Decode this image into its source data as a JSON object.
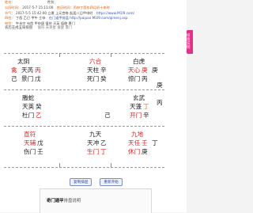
{
  "header": {
    "lines": [
      {
        "label": "姓名：",
        "value": "",
        "extra": "性别："
      },
      {
        "label": "公历时间：",
        "value": "2017-5-7 15:11:00",
        "extra": "农历时间：丙申丁酉年四月初十申时"
      },
      {
        "label": "节气：",
        "value": "2017-5-5 15:42:00 立夏 上元宫卷 起居八日甲申时",
        "extra": "https://www.M1I9.com/"
      },
      {
        "label": "四柱：",
        "value": "丁酉 乙巳 甲午 壬申",
        "extra": "在门道甲排盘 http://paipan.M1I9.com/qimenj.asp"
      },
      {
        "label": "旬空：",
        "value": "午未空 旬首 甲申庚 值符 天英 值使 景门",
        "extra": ""
      }
    ],
    "subline": "农历壬戌五局排盘",
    "subline_gray": "值符 天英星  值使 景门"
  },
  "cells": [
    {
      "god": "太阴",
      "rows": [
        [
          "禽",
          "天芮",
          "丙"
        ],
        [
          "己",
          "景门",
          "戊"
        ]
      ]
    },
    {
      "god": "六合",
      "rows": [
        [
          "",
          "天柱",
          "辛"
        ],
        [
          "",
          "死门",
          "癸"
        ]
      ]
    },
    {
      "god": "白虎",
      "rows": [
        [
          "",
          "天心",
          "庚"
        ],
        [
          "",
          "惊门",
          "丙"
        ]
      ]
    },
    {
      "god": "螣蛇",
      "rows": [
        [
          "",
          "天英",
          "癸"
        ],
        [
          "",
          "杜门",
          "乙"
        ]
      ]
    },
    {
      "god": "",
      "rows": [
        [
          "",
          "",
          ""
        ],
        [
          "",
          "",
          "己"
        ]
      ]
    },
    {
      "god": "玄武",
      "rows": [
        [
          "",
          "天蓬",
          "丁"
        ],
        [
          "",
          "开门",
          "辛"
        ]
      ]
    },
    {
      "god": "直符",
      "rows": [
        [
          "",
          "天辅",
          "戊"
        ],
        [
          "",
          "伤门",
          "壬"
        ]
      ]
    },
    {
      "god": "九天",
      "rows": [
        [
          "",
          "天冲",
          "乙"
        ],
        [
          "",
          "生门",
          "丁"
        ]
      ]
    },
    {
      "god": "九地",
      "rows": [
        [
          "",
          "天任",
          "壬"
        ],
        [
          "",
          "休门",
          "庚"
        ]
      ]
    }
  ],
  "side_left": [
    "庚",
    "丁"
  ],
  "side_right": [
    "庚",
    "丙"
  ],
  "buttons": {
    "copy": "复制排盘",
    "restart": "重新开始"
  },
  "footer": {
    "title": "奇门遁甲",
    "title_suffix": "排盘说明"
  },
  "side_tab": "排盘说明",
  "colors": {
    "accent_red": "#e02020",
    "accent_orange": "#f07000",
    "link_blue": "#2b57b8"
  }
}
